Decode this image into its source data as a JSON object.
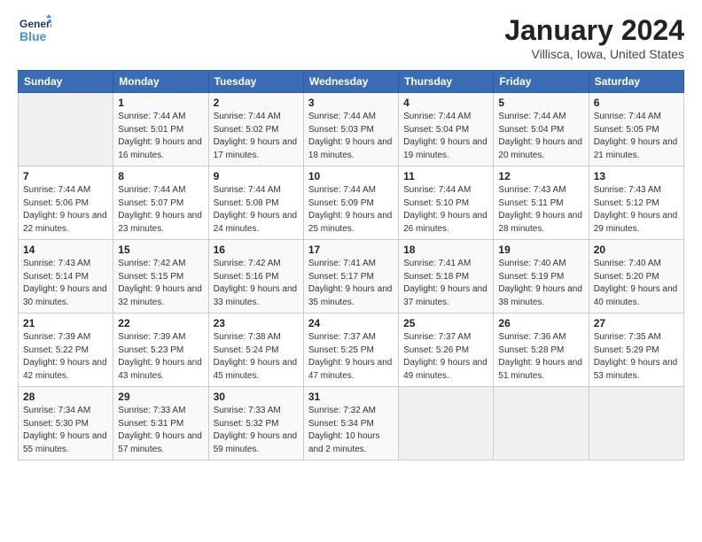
{
  "header": {
    "logo_line1": "General",
    "logo_line2": "Blue",
    "month": "January 2024",
    "location": "Villisca, Iowa, United States"
  },
  "weekdays": [
    "Sunday",
    "Monday",
    "Tuesday",
    "Wednesday",
    "Thursday",
    "Friday",
    "Saturday"
  ],
  "weeks": [
    [
      {
        "day": "",
        "sunrise": "",
        "sunset": "",
        "daylight": ""
      },
      {
        "day": "1",
        "sunrise": "7:44 AM",
        "sunset": "5:01 PM",
        "daylight": "9 hours and 16 minutes."
      },
      {
        "day": "2",
        "sunrise": "7:44 AM",
        "sunset": "5:02 PM",
        "daylight": "9 hours and 17 minutes."
      },
      {
        "day": "3",
        "sunrise": "7:44 AM",
        "sunset": "5:03 PM",
        "daylight": "9 hours and 18 minutes."
      },
      {
        "day": "4",
        "sunrise": "7:44 AM",
        "sunset": "5:04 PM",
        "daylight": "9 hours and 19 minutes."
      },
      {
        "day": "5",
        "sunrise": "7:44 AM",
        "sunset": "5:04 PM",
        "daylight": "9 hours and 20 minutes."
      },
      {
        "day": "6",
        "sunrise": "7:44 AM",
        "sunset": "5:05 PM",
        "daylight": "9 hours and 21 minutes."
      }
    ],
    [
      {
        "day": "7",
        "sunrise": "7:44 AM",
        "sunset": "5:06 PM",
        "daylight": "9 hours and 22 minutes."
      },
      {
        "day": "8",
        "sunrise": "7:44 AM",
        "sunset": "5:07 PM",
        "daylight": "9 hours and 23 minutes."
      },
      {
        "day": "9",
        "sunrise": "7:44 AM",
        "sunset": "5:08 PM",
        "daylight": "9 hours and 24 minutes."
      },
      {
        "day": "10",
        "sunrise": "7:44 AM",
        "sunset": "5:09 PM",
        "daylight": "9 hours and 25 minutes."
      },
      {
        "day": "11",
        "sunrise": "7:44 AM",
        "sunset": "5:10 PM",
        "daylight": "9 hours and 26 minutes."
      },
      {
        "day": "12",
        "sunrise": "7:43 AM",
        "sunset": "5:11 PM",
        "daylight": "9 hours and 28 minutes."
      },
      {
        "day": "13",
        "sunrise": "7:43 AM",
        "sunset": "5:12 PM",
        "daylight": "9 hours and 29 minutes."
      }
    ],
    [
      {
        "day": "14",
        "sunrise": "7:43 AM",
        "sunset": "5:14 PM",
        "daylight": "9 hours and 30 minutes."
      },
      {
        "day": "15",
        "sunrise": "7:42 AM",
        "sunset": "5:15 PM",
        "daylight": "9 hours and 32 minutes."
      },
      {
        "day": "16",
        "sunrise": "7:42 AM",
        "sunset": "5:16 PM",
        "daylight": "9 hours and 33 minutes."
      },
      {
        "day": "17",
        "sunrise": "7:41 AM",
        "sunset": "5:17 PM",
        "daylight": "9 hours and 35 minutes."
      },
      {
        "day": "18",
        "sunrise": "7:41 AM",
        "sunset": "5:18 PM",
        "daylight": "9 hours and 37 minutes."
      },
      {
        "day": "19",
        "sunrise": "7:40 AM",
        "sunset": "5:19 PM",
        "daylight": "9 hours and 38 minutes."
      },
      {
        "day": "20",
        "sunrise": "7:40 AM",
        "sunset": "5:20 PM",
        "daylight": "9 hours and 40 minutes."
      }
    ],
    [
      {
        "day": "21",
        "sunrise": "7:39 AM",
        "sunset": "5:22 PM",
        "daylight": "9 hours and 42 minutes."
      },
      {
        "day": "22",
        "sunrise": "7:39 AM",
        "sunset": "5:23 PM",
        "daylight": "9 hours and 43 minutes."
      },
      {
        "day": "23",
        "sunrise": "7:38 AM",
        "sunset": "5:24 PM",
        "daylight": "9 hours and 45 minutes."
      },
      {
        "day": "24",
        "sunrise": "7:37 AM",
        "sunset": "5:25 PM",
        "daylight": "9 hours and 47 minutes."
      },
      {
        "day": "25",
        "sunrise": "7:37 AM",
        "sunset": "5:26 PM",
        "daylight": "9 hours and 49 minutes."
      },
      {
        "day": "26",
        "sunrise": "7:36 AM",
        "sunset": "5:28 PM",
        "daylight": "9 hours and 51 minutes."
      },
      {
        "day": "27",
        "sunrise": "7:35 AM",
        "sunset": "5:29 PM",
        "daylight": "9 hours and 53 minutes."
      }
    ],
    [
      {
        "day": "28",
        "sunrise": "7:34 AM",
        "sunset": "5:30 PM",
        "daylight": "9 hours and 55 minutes."
      },
      {
        "day": "29",
        "sunrise": "7:33 AM",
        "sunset": "5:31 PM",
        "daylight": "9 hours and 57 minutes."
      },
      {
        "day": "30",
        "sunrise": "7:33 AM",
        "sunset": "5:32 PM",
        "daylight": "9 hours and 59 minutes."
      },
      {
        "day": "31",
        "sunrise": "7:32 AM",
        "sunset": "5:34 PM",
        "daylight": "10 hours and 2 minutes."
      },
      {
        "day": "",
        "sunrise": "",
        "sunset": "",
        "daylight": ""
      },
      {
        "day": "",
        "sunrise": "",
        "sunset": "",
        "daylight": ""
      },
      {
        "day": "",
        "sunrise": "",
        "sunset": "",
        "daylight": ""
      }
    ]
  ],
  "labels": {
    "sunrise_prefix": "Sunrise: ",
    "sunset_prefix": "Sunset: ",
    "daylight_prefix": "Daylight: "
  }
}
